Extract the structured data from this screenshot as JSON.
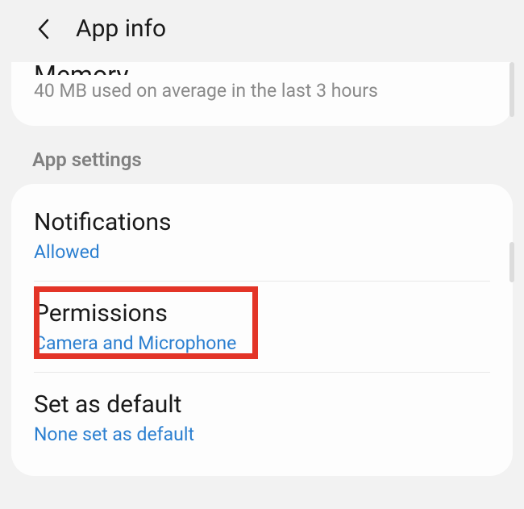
{
  "header": {
    "title": "App info"
  },
  "memory": {
    "title": "Memory",
    "subtitle": "40 MB used on average in the last 3 hours"
  },
  "section_label": "App settings",
  "items": {
    "notifications": {
      "title": "Notifications",
      "subtitle": "Allowed"
    },
    "permissions": {
      "title": "Permissions",
      "subtitle": "Camera and Microphone"
    },
    "set_default": {
      "title": "Set as default",
      "subtitle": "None set as default"
    }
  }
}
